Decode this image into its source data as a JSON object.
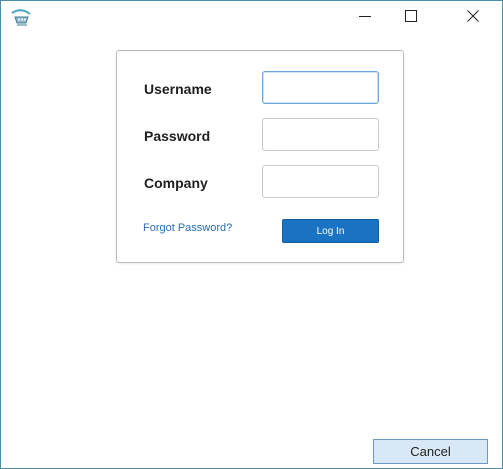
{
  "window": {
    "controls": {
      "minimize_icon": "minimize-icon",
      "maximize_icon": "maximize-icon",
      "close_icon": "close-icon"
    },
    "app_icon": "tram-app-icon",
    "border_color": "#4a8fa8"
  },
  "login": {
    "username_label": "Username",
    "username_value": "",
    "password_label": "Password",
    "password_value": "",
    "company_label": "Company",
    "company_value": "",
    "forgot_password": "Forgot Password?",
    "login_button": "Log In",
    "accent_color": "#1a73c2",
    "link_color": "#2a6fb7"
  },
  "footer": {
    "cancel_button": "Cancel"
  }
}
